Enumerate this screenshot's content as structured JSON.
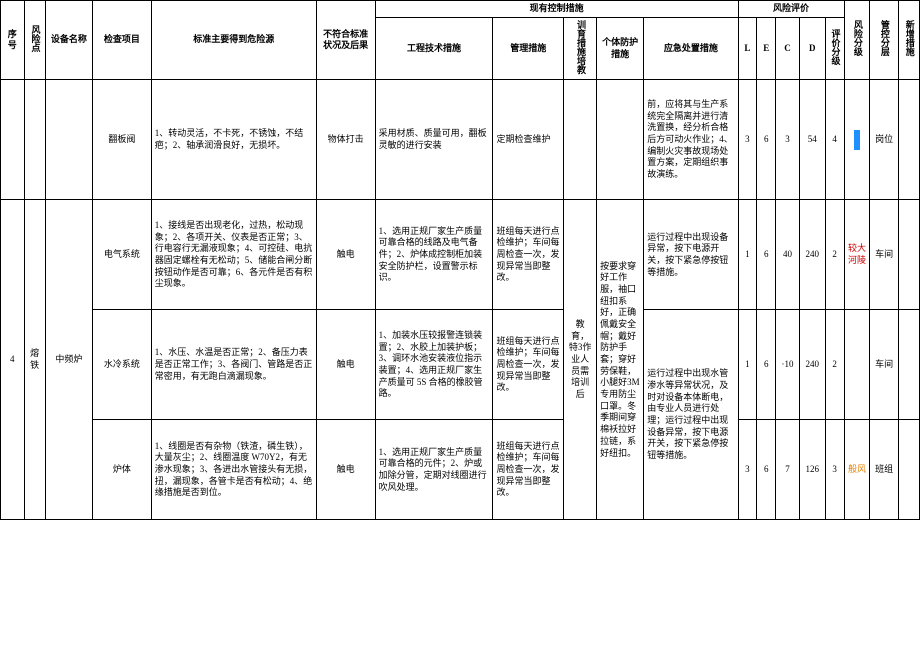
{
  "headers": {
    "seq": "序号",
    "riskPoint": "风险点",
    "deviceName": "设备名称",
    "checkItem": "检查项目",
    "mainHazard": "标准主要得到危险源",
    "nonConform": "不符合标准状况及后果",
    "currentControl": "现有控制措施",
    "engTech": "工程技术措施",
    "mgmt": "管理措施",
    "trainEdu": "训育措施培教",
    "ppe": "个体防护措施",
    "emergency": "应急处置措施",
    "riskEval": "风险评价",
    "L": "L",
    "E": "E",
    "C": "C",
    "D": "D",
    "evalLevel": "评价分级",
    "riskLevel": "风险分级",
    "controlLayer": "管控分层",
    "newMeasure": "新增措施"
  },
  "row1": {
    "checkItem": "翻板阀",
    "hazard": "1、转动灵活，不卡死，不锈蚀，不结疤；2、轴承润滑良好，无损坏。",
    "nonConform": "物体打击",
    "engTech": "采用材质、质量可用，翻板灵敏的进行安装",
    "mgmt": "定期检查维护",
    "emergency": "前，应将其与生产系统完全隔离并进行清洗置换，经分析合格后方可动火作业；4、编制火灾事故现场处置方案，定期组织事故演练。",
    "L": "3",
    "E": "6",
    "C": "3",
    "D": "54",
    "eval": "4",
    "controlLayer": "岗位"
  },
  "row2": {
    "seq": "4",
    "riskPoint": "熔铁",
    "deviceName": "中频炉",
    "checkItem": "电气系统",
    "hazard": "1、接线是否出现老化，过热，松动现象；2、各项开关、仪表是否正常；3、行电容行无漏液现象；4、可控硅、电抗器固定螺栓有无松动；5、储能合闸分断按钮动作是否可靠；6、各元件是否有积尘现象。",
    "nonConform": "触电",
    "engTech": "1、选用正规厂家生产质量可靠合格的线路及电气备件；2、炉体成控制柜加装安全防护栏，设置警示标识。",
    "mgmt": "班组每天进行点检维护；车间每周检查一次，发现异常当即整改。",
    "ppe": "按要求穿好工作服，袖口纽扣系好，正确佩戴安全帽；戴好防护手套；穿好劳保鞋，小腿好3M专用防尘口罩。冬季期间穿棉袄拉好拉链，系好纽扣。",
    "emergency": "运行过程中出现设备异常，按下电源开关，按下紧急停按钮等措施。",
    "L": "1",
    "E": "6",
    "C": "40",
    "D": "240",
    "eval": "2",
    "riskLevel": "较大河陵",
    "controlLayer": "车间"
  },
  "row3": {
    "checkItem": "水冷系统",
    "hazard": "1、水压、水温是否正常；2、备压力表是否正常工作；3、各阀门、管路是否正常密用，有无跑白滴漏现象。",
    "nonConform": "触电",
    "engTech": "1、加装水压较报警连锁装置；2、水胶上加装护板；3、调环水池安装液位指示装置；4、选用正规厂家生产质量可 5S 合格的橡胶管路。",
    "mgmt": "班组每天进行点检维护；车间每周检查一次，发现异常当即整改。",
    "emergency": "运行过程中出现水管渗水等异常状况，及时对设备本体断电，由专业人员进行处理；运行过程中出现设备异常，按下电源开关，按下紧急停按钮等措施。",
    "L": "1",
    "E": "6",
    "C": "·10",
    "D": "240",
    "eval": "2",
    "controlLayer": "车间"
  },
  "row4": {
    "checkItem": "炉体",
    "hazard": "1、线圈是否有杂物（铁渣，磷生铁），大量灰尘；2、线圈温度 W70Y2，有无渗水现象；3、各进出水管接头有无损，扭，漏现象，各管卡是否有松动；4、绝缘措施是否到位。",
    "nonConform": "触电",
    "engTech": "1、选用正规厂家生产质量可靠合格的元件；2、炉或加除分管，定期对线圈进行吹风处理。",
    "mgmt": "班组每天进行点检维护；车间每周检查一次，发现异常当即整改。",
    "trainEdu": "教育，特3作业人员需培训后",
    "L": "3",
    "E": "6",
    "C": "7",
    "D": "126",
    "eval": "3",
    "riskLevel": "般风",
    "controlLayer": "班组"
  }
}
